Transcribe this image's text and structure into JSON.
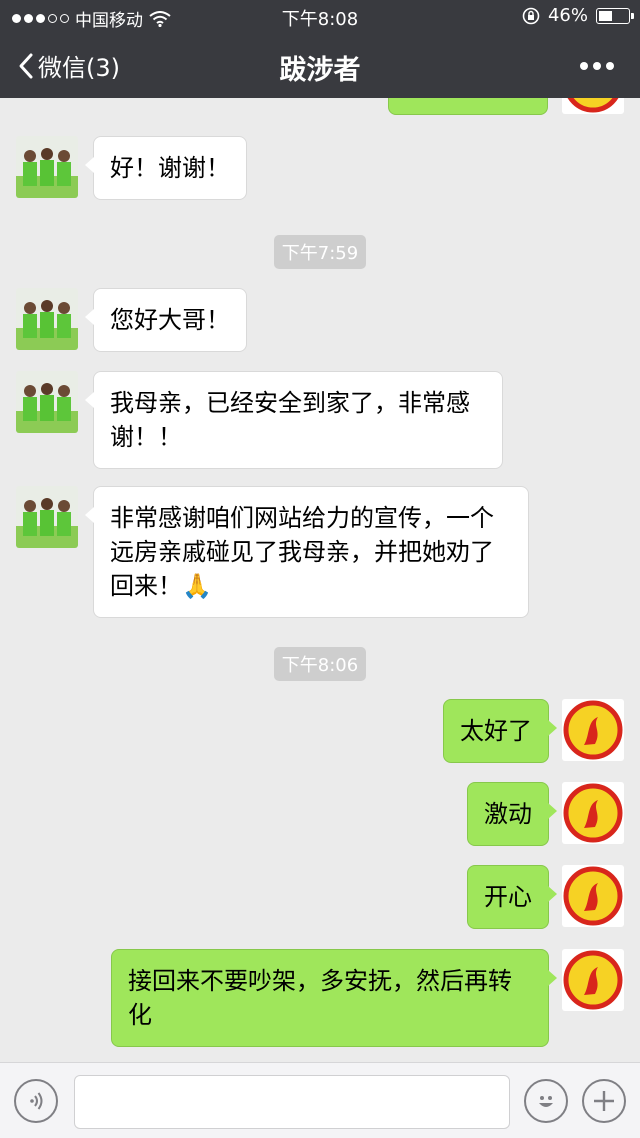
{
  "status_bar": {
    "carrier": "中国移动",
    "time": "下午8:08",
    "battery": "46%",
    "battery_level": 0.46
  },
  "nav": {
    "back_label": "微信(3)",
    "title": "跋涉者"
  },
  "timestamps": [
    "下午7:59",
    "下午8:06"
  ],
  "messages": [
    {
      "side": "left",
      "text": "好！谢谢！"
    },
    {
      "side": "left",
      "text": "您好大哥！"
    },
    {
      "side": "left",
      "text": "我母亲，已经安全到家了，非常感谢！！"
    },
    {
      "side": "left",
      "text": "非常感谢咱们网站给力的宣传，一个远房亲戚碰见了我母亲，并把她劝了回来！🙏"
    },
    {
      "side": "right",
      "text": "太好了"
    },
    {
      "side": "right",
      "text": "激动"
    },
    {
      "side": "right",
      "text": "开心"
    },
    {
      "side": "right",
      "text": "接回来不要吵架，多安抚，然后再转化"
    }
  ],
  "colors": {
    "nav_bg": "#393a3f",
    "chat_bg": "#ebebeb",
    "sent_bubble": "#9fe65b",
    "received_bubble": "#ffffff"
  }
}
